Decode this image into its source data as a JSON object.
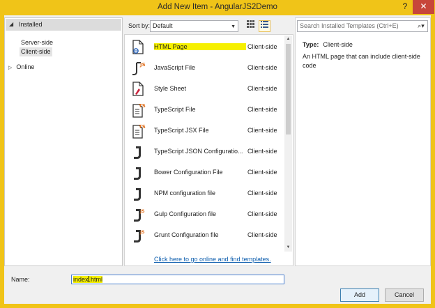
{
  "window": {
    "title": "Add New Item - AngularJS2Demo",
    "help_glyph": "?",
    "close_glyph": "✕"
  },
  "sidebar": {
    "installed_label": "Installed",
    "items": [
      {
        "label": "Server-side"
      },
      {
        "label": "Client-side",
        "selected": true
      }
    ],
    "online_label": "Online"
  },
  "toolbar": {
    "sort_label": "Sort by:",
    "sort_value": "Default",
    "grid_view_icon": "grid-view-icon",
    "list_view_icon": "list-view-icon"
  },
  "templates": [
    {
      "name": "HTML Page",
      "category": "Client-side",
      "icon": "html-page-icon",
      "selected": true
    },
    {
      "name": "JavaScript File",
      "category": "Client-side",
      "icon": "javascript-file-icon"
    },
    {
      "name": "Style Sheet",
      "category": "Client-side",
      "icon": "style-sheet-icon"
    },
    {
      "name": "TypeScript File",
      "category": "Client-side",
      "icon": "typescript-file-icon"
    },
    {
      "name": "TypeScript JSX File",
      "category": "Client-side",
      "icon": "typescript-jsx-file-icon"
    },
    {
      "name": "TypeScript JSON Configuratio...",
      "category": "Client-side",
      "icon": "json-config-icon"
    },
    {
      "name": "Bower Configuration File",
      "category": "Client-side",
      "icon": "json-config-icon"
    },
    {
      "name": "NPM configuration file",
      "category": "Client-side",
      "icon": "json-config-icon"
    },
    {
      "name": "Gulp Configuration file",
      "category": "Client-side",
      "icon": "gulp-config-icon"
    },
    {
      "name": "Grunt Configuration file",
      "category": "Client-side",
      "icon": "grunt-config-icon"
    }
  ],
  "online_link": "Click here to go online and find templates.",
  "details": {
    "search_placeholder": "Search Installed Templates (Ctrl+E)",
    "type_label": "Type:",
    "type_value": "Client-side",
    "description": "An HTML page that can include client-side code"
  },
  "footer": {
    "name_label": "Name:",
    "name_value_part1": "index",
    "name_value_part2": "html",
    "add_label": "Add",
    "cancel_label": "Cancel"
  },
  "colors": {
    "title_bar": "#f0c418",
    "close_button": "#c7463a",
    "highlight": "#f6f000",
    "link": "#0b5cad"
  }
}
